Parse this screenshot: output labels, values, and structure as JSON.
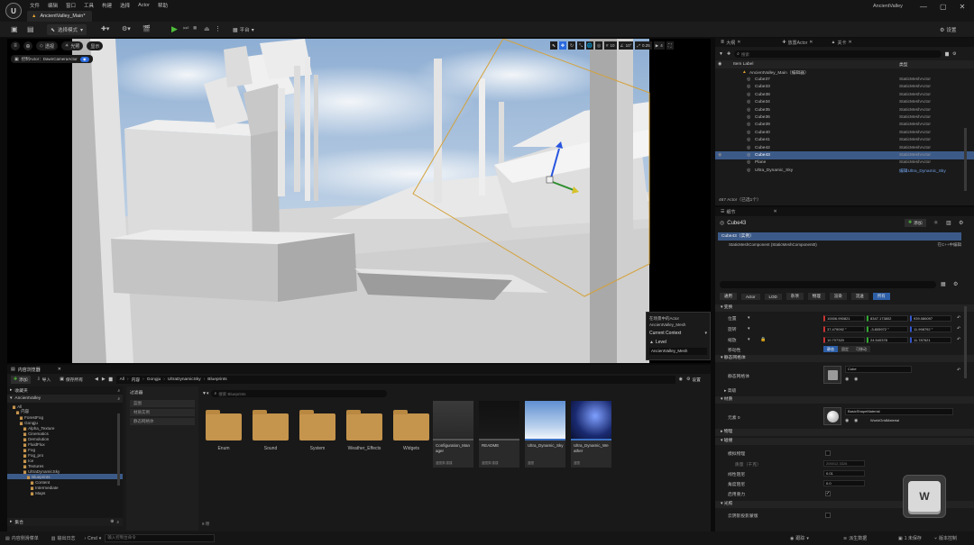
{
  "title_bar": {
    "menu": [
      "文件",
      "编辑",
      "窗口",
      "工具",
      "构建",
      "选择",
      "Actor",
      "帮助"
    ],
    "doc_tab": "AncientValley_Main*",
    "project": "AncientValley"
  },
  "toolbar": {
    "save_label": "",
    "mode_label": "选择模式",
    "platform_label": "平台",
    "settings_label": "设置"
  },
  "viewport": {
    "perspective_label": "透视",
    "lit_label": "光照",
    "show_label": "显示",
    "pilot_label": "控制Actor：DawnCameraActor",
    "grid_snap": "10",
    "rot_snap": "10°",
    "scale_snap": "0.25",
    "cam_speed": "4",
    "popup": {
      "line1": "在场景中的Actor",
      "line2": "AncientValley_Mesh",
      "current_context": "Current Context",
      "level_label": "Level",
      "level_value": "AncientValley_Mesh"
    }
  },
  "outliner": {
    "tabs": [
      "大纲",
      "放置Actor",
      "关卡"
    ],
    "search_placeholder": "搜索",
    "col_label": "Item Label",
    "col_type": "类型",
    "root": "AncientValley_Main（编辑器）",
    "rows": [
      {
        "name": "Cube37",
        "type": "StaticMeshActor"
      },
      {
        "name": "Cube33",
        "type": "StaticMeshActor"
      },
      {
        "name": "Cube38",
        "type": "StaticMeshActor"
      },
      {
        "name": "Cube34",
        "type": "StaticMeshActor"
      },
      {
        "name": "Cube35",
        "type": "StaticMeshActor"
      },
      {
        "name": "Cube36",
        "type": "StaticMeshActor"
      },
      {
        "name": "Cube39",
        "type": "StaticMeshActor"
      },
      {
        "name": "Cube40",
        "type": "StaticMeshActor"
      },
      {
        "name": "Cube41",
        "type": "StaticMeshActor"
      },
      {
        "name": "Cube42",
        "type": "StaticMeshActor"
      },
      {
        "name": "Cube43",
        "type": "StaticMeshActor"
      },
      {
        "name": "Plane",
        "type": "StaticMeshActor"
      },
      {
        "name": "Ultra_Dynamic_Sky",
        "type": "编辑Ultra_Dynamic_Sky"
      }
    ],
    "selected_index": 10,
    "footer": "467 Actor（已选1个）"
  },
  "details": {
    "tab_label": "细节",
    "actor_name": "Cube43",
    "add_label": "添加",
    "instance_label": "Cube43（实例）",
    "component_label": "StaticMeshComponent (StaticMeshComponent0)",
    "edit_in_cpp": "在C++中编辑",
    "filter_tabs": [
      "通用",
      "Actor",
      "LOD",
      "杂项",
      "物理",
      "渲染",
      "流送",
      "所有"
    ],
    "transform_header": "变换",
    "location_label": "位置",
    "rotation_label": "旋转",
    "scale_label": "缩放",
    "location": [
      "10006.990821",
      "8347.173802",
      "939.086097"
    ],
    "rotation": [
      "37.479092 °",
      "-3.805972 °",
      "11.998792 °"
    ],
    "scale": [
      "10.707320",
      "24.540378",
      "11.787621"
    ],
    "mobility_label": "移动性",
    "mobility_options": [
      "静态",
      "固定",
      "可移动"
    ],
    "static_mesh_header": "静态网格体",
    "static_mesh_label": "静态网格体",
    "static_mesh_value": "Cube",
    "advanced_label": "高级",
    "materials_header": "材质",
    "element0_label": "元素 0",
    "material_value": "BasicShapeMaterial",
    "material_type": "WorldGridMaterial",
    "physics_header": "物理",
    "collision_header": "碰撞",
    "simulate_label": "模拟物理",
    "mass_label": "质量（千克）",
    "mass_value": "200012.3326",
    "linear_damping_label": "线性阻尼",
    "linear_damping_value": "0.01",
    "angular_damping_label": "角度阻尼",
    "angular_damping_value": "0.0",
    "gravity_label": "启用重力",
    "lighting_header": "光照",
    "cast_shadow_label": "云阴影投影蒙版"
  },
  "content_browser": {
    "tab_label": "内容浏览器",
    "add_label": "添加",
    "import_label": "导入",
    "save_all_label": "保存所有",
    "breadcrumb": [
      "All",
      "内容",
      "Gongju",
      "UltraDynamicSky",
      "Blueprints"
    ],
    "settings_label": "设置",
    "favorites_label": "收藏夹",
    "project_label": "AncientValley",
    "collections_label": "集合",
    "filter_label": "过滤器",
    "filters": [
      "蓝图",
      "材质实例",
      "静态网格体"
    ],
    "search_placeholder": "搜索 Blueprints",
    "tree": [
      "All",
      "内容",
      "ForestFog",
      "Gongju",
      "Alpha_Texture",
      "Cinematics",
      "Demolution",
      "FluidFlux",
      "Fog",
      "Fog_pro",
      "Ice",
      "Textures",
      "UltraDynamicSky",
      "Blueprints",
      "Content",
      "Intermediate",
      "Maps"
    ],
    "folders": [
      "Enum",
      "Sound",
      "System",
      "Weather_Effects",
      "Widgets"
    ],
    "assets": [
      {
        "name": "Configuration_Manager",
        "type": "蓝图类/重建"
      },
      {
        "name": "README",
        "type": "蓝图类/重建"
      },
      {
        "name": "Ultra_Dynamic_Sky",
        "type": "蓝图"
      },
      {
        "name": "Ultra_Dynamic_Weather",
        "type": "蓝图"
      }
    ],
    "item_count": "9 项"
  },
  "status_bar": {
    "drawer": "内容侧滑菜单",
    "output_log": "输出日志",
    "cmd": "Cmd",
    "cmd_placeholder": "输入控制台命令",
    "trace": "跟踪",
    "derived_data": "派生数据",
    "unsaved": "1 未保存",
    "source_control": "版本控制"
  },
  "overlay": {
    "key": "W"
  }
}
